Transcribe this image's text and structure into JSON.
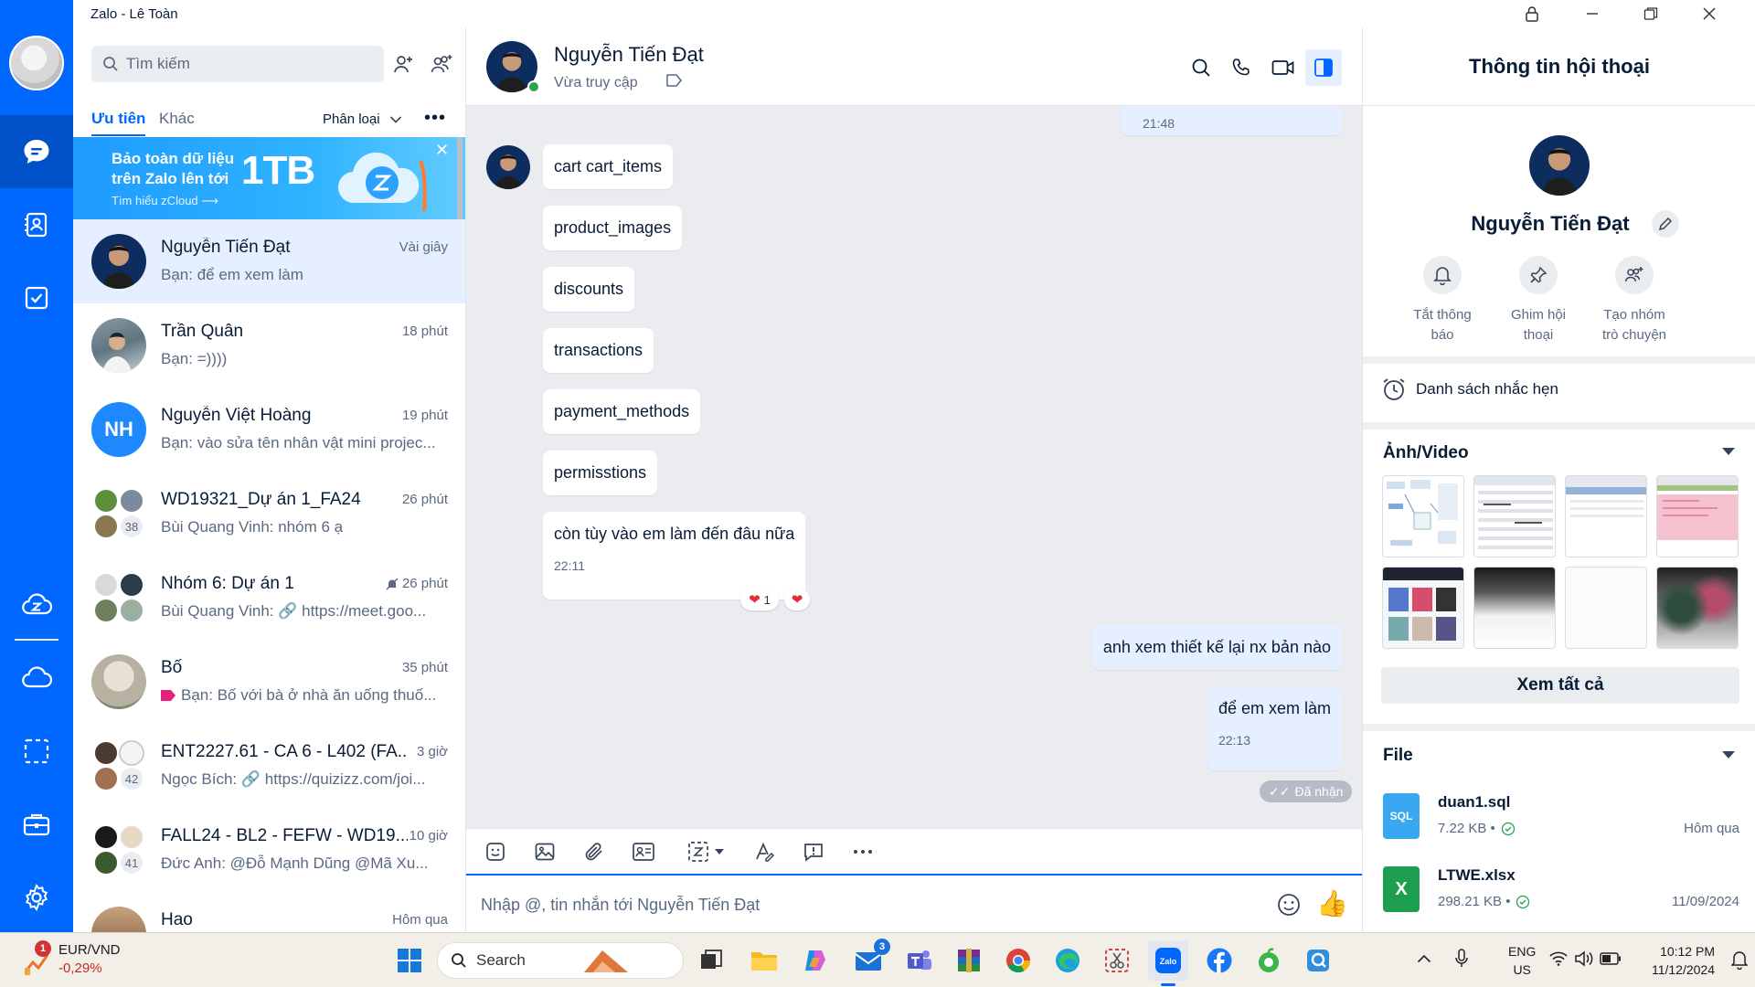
{
  "window": {
    "title": "Zalo - Lê Toàn"
  },
  "colors": {
    "accent": "#0068ff",
    "selected_row": "#e5efff",
    "chat_bg": "#ebecf0",
    "my_bubble": "#e5efff"
  },
  "list": {
    "search_placeholder": "Tìm kiếm",
    "tabs": [
      "Ưu tiên",
      "Khác"
    ],
    "sort_label": "Phân loại",
    "banner": {
      "line1": "Bảo toàn dữ liệu",
      "line2": "trên Zalo lên tới",
      "highlight": "1TB",
      "link": "Tìm hiểu zCloud"
    },
    "conversations": [
      {
        "name": "Nguyễn Tiến Đạt",
        "time": "Vài giây",
        "preview": "Bạn: để em xem làm"
      },
      {
        "name": "Trần Quân",
        "time": "18 phút",
        "preview": "Bạn: =))))"
      },
      {
        "name": "Nguyễn Việt Hoàng",
        "time": "19 phút",
        "preview": "Bạn: vào sửa tên nhân vật mini projec...",
        "initials": "NH"
      },
      {
        "name": "WD19321_Dự án 1_FA24",
        "time": "26 phút",
        "preview": "Bùi Quang Vinh: nhóm 6 ạ",
        "member_count": "38"
      },
      {
        "name": "Nhóm 6: Dự án 1",
        "time": "26 phút",
        "preview": "Bùi Quang Vinh: 🔗 https://meet.goo..."
      },
      {
        "name": "Bố",
        "time": "35 phút",
        "preview": "Bạn: Bố với bà ở nhà ăn uống thuố..."
      },
      {
        "name": "ENT2227.61 - CA 6 - L402 (FA...",
        "time": "3 giờ",
        "preview": "Ngọc Bích: 🔗 https://quizizz.com/joi...",
        "member_count": "42"
      },
      {
        "name": "FALL24 - BL2 - FEFW - WD19...",
        "time": "10 giờ",
        "preview": "Đức Anh: @Đỗ Mạnh Dũng @Mã Xu...",
        "member_count": "41"
      },
      {
        "name": "Hao",
        "time": "Hôm qua",
        "preview": ""
      }
    ]
  },
  "chat": {
    "contact_name": "Nguyễn Tiến Đạt",
    "status": "Vừa truy cập",
    "top_partial_time": "21:48",
    "incoming": [
      "cart cart_items",
      "product_images",
      "discounts",
      "transactions",
      "payment_methods",
      "permisstions"
    ],
    "last_incoming": {
      "text": "còn tùy vào em làm đến đâu nữa",
      "time": "22:11",
      "reaction_count": "1"
    },
    "outgoing": [
      {
        "text": "anh xem thiết kế lại nx bản nào"
      },
      {
        "text": "để em xem làm",
        "time": "22:13"
      }
    ],
    "receipt": "Đã nhận",
    "input_placeholder": "Nhập @, tin nhắn tới Nguyễn Tiến Đạt"
  },
  "info": {
    "title": "Thông tin hội thoại",
    "name": "Nguyễn Tiến Đạt",
    "actions": [
      {
        "line1": "Tắt thông",
        "line2": "báo",
        "icon": "bell-icon"
      },
      {
        "line1": "Ghim hội",
        "line2": "thoại",
        "icon": "pin-icon"
      },
      {
        "line1": "Tạo nhóm",
        "line2": "trò chuyện",
        "icon": "add-group-icon"
      }
    ],
    "reminder": "Danh sách nhắc hẹn",
    "media_title": "Ảnh/Video",
    "see_all": "Xem tất cả",
    "file_title": "File",
    "files": [
      {
        "name": "duan1.sql",
        "size": "7.22 KB •",
        "date": "Hôm qua",
        "type": "SQL",
        "color": "#3aa8f0"
      },
      {
        "name": "LTWE.xlsx",
        "size": "298.21 KB •",
        "date": "11/09/2024",
        "type": "X",
        "color": "#1e9e4f"
      }
    ]
  },
  "taskbar": {
    "fx_pair": "EUR/VND",
    "fx_change": "-0,29%",
    "fx_badge": "1",
    "search": "Search",
    "mail_badge": "3",
    "lang1": "ENG",
    "lang2": "US",
    "time": "10:12 PM",
    "date": "11/12/2024"
  }
}
